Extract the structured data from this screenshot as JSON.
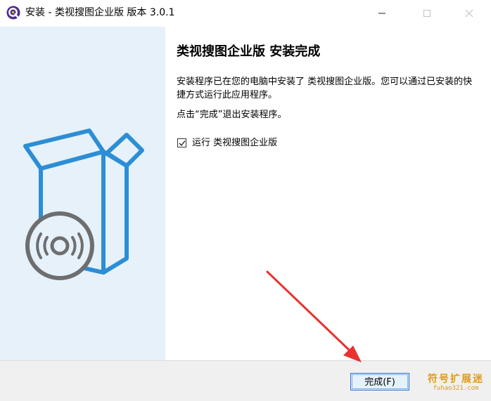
{
  "window": {
    "title": "安装 - 类视搜图企业版 版本 3.0.1",
    "controls": {
      "minimize": "minimize",
      "maximize": "maximize",
      "close": "close"
    }
  },
  "left_panel": {
    "icon": "software-box-disc-icon"
  },
  "content": {
    "heading": "类视搜图企业版 安装完成",
    "paragraph1": "安装程序已在您的电脑中安装了 类视搜图企业版。您可以通过已安装的快捷方式运行此应用程序。",
    "paragraph2": "点击“完成”退出安装程序。",
    "run_checkbox": {
      "label": "运行 类视搜图企业版",
      "checked": true
    }
  },
  "footer": {
    "finish_button": "完成(F)",
    "watermark": {
      "cn": "符号扩展迷",
      "en": "fuhao321.com"
    }
  },
  "colors": {
    "accent_blue": "#2b8ed6",
    "disc_gray": "#6e6e6e",
    "left_panel_bg": "#e6f1fa",
    "arrow_red": "#e8322f",
    "watermark_orange": "#e09a1a"
  }
}
